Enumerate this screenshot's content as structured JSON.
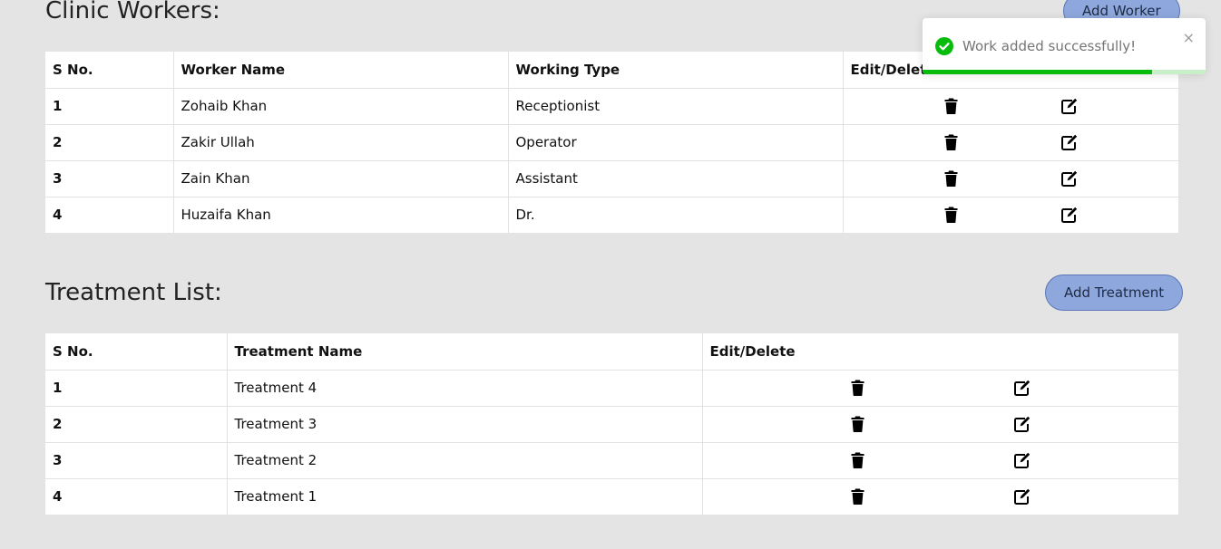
{
  "workers": {
    "title": "Clinic Workers:",
    "add_label": "Add Worker",
    "headers": [
      "S No.",
      "Worker Name",
      "Working Type",
      "Edit/Delete"
    ],
    "rows": [
      {
        "sno": "1",
        "name": "Zohaib Khan",
        "type": "Receptionist"
      },
      {
        "sno": "2",
        "name": "Zakir Ullah",
        "type": "Operator"
      },
      {
        "sno": "3",
        "name": "Zain Khan",
        "type": "Assistant"
      },
      {
        "sno": "4",
        "name": "Huzaifa Khan",
        "type": "Dr."
      }
    ]
  },
  "treatments": {
    "title": "Treatment List:",
    "add_label": "Add Treatment",
    "headers": [
      "S No.",
      "Treatment Name",
      "Edit/Delete"
    ],
    "rows": [
      {
        "sno": "1",
        "name": "Treatment 4"
      },
      {
        "sno": "2",
        "name": "Treatment 3"
      },
      {
        "sno": "3",
        "name": "Treatment 2"
      },
      {
        "sno": "4",
        "name": "Treatment 1"
      }
    ]
  },
  "toast": {
    "message": "Work added successfully!",
    "close": "×",
    "progress": 0.81
  },
  "icons": {
    "delete": "trash-icon",
    "edit": "edit-icon",
    "success": "check-circle-icon"
  },
  "colors": {
    "accent": "#8ea8de",
    "success": "#07bc0c",
    "background": "#e4e4e4"
  }
}
